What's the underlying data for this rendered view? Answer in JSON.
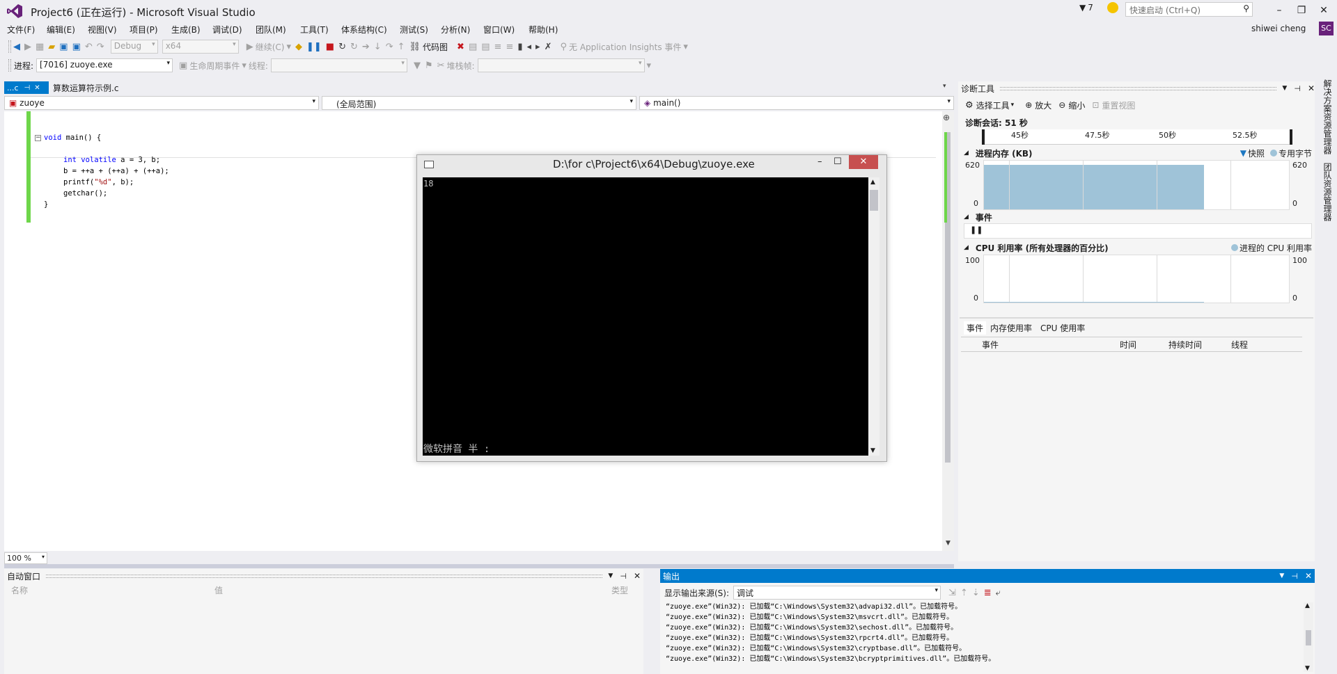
{
  "window": {
    "title": "Project6 (正在运行) - Microsoft Visual Studio",
    "notification_count": "7",
    "quick_launch_placeholder": "快速启动 (Ctrl+Q)",
    "user_name": "shiwei cheng",
    "user_initials": "SC"
  },
  "menu": [
    "文件(F)",
    "编辑(E)",
    "视图(V)",
    "项目(P)",
    "生成(B)",
    "调试(D)",
    "团队(M)",
    "工具(T)",
    "体系结构(C)",
    "测试(S)",
    "分析(N)",
    "窗口(W)",
    "帮助(H)"
  ],
  "toolbar": {
    "config": "Debug",
    "platform": "x64",
    "continue_label": "继续(C)",
    "code_map_label": "代码图",
    "app_insights_label": "无 Application Insights 事件"
  },
  "debug_toolbar": {
    "process_label": "进程:",
    "process_value": "[7016] zuoye.exe",
    "lifecycle_label": "生命周期事件",
    "thread_label": "线程:",
    "stack_label": "堆栈帧:"
  },
  "tabs": {
    "pinned": "...c",
    "active": "算数运算符示例.c"
  },
  "navbar": {
    "project": "zuoye",
    "scope": "(全局范围)",
    "member": "main()"
  },
  "code_lines": [
    "void main() {",
    "",
    "int  volatile a = 3, b;",
    "b = ++a + (++a) + (++a);",
    "printf(\"%d\", b);",
    "getchar();",
    "}"
  ],
  "zoom": "100 %",
  "console": {
    "title": "D:\\for c\\Project6\\x64\\Debug\\zuoye.exe",
    "output": "18",
    "ime": "微软拼音 半 :"
  },
  "diagnostics": {
    "title": "诊断工具",
    "select_tools": "选择工具",
    "zoom_in": "放大",
    "zoom_out": "缩小",
    "reset_view": "重置视图",
    "session": "诊断会话: 51 秒",
    "timeline_ticks": [
      "45秒",
      "47.5秒",
      "50秒",
      "52.5秒"
    ],
    "memory": {
      "title": "进程内存 (KB)",
      "legend_snapshot": "快照",
      "legend_private": "专用字节",
      "y_max": "620",
      "y_min": "0"
    },
    "events_title": "事件",
    "cpu": {
      "title": "CPU 利用率 (所有处理器的百分比)",
      "legend": "进程的 CPU 利用率",
      "y_max": "100",
      "y_min": "0"
    },
    "bottom_tabs": [
      "事件",
      "内存使用率",
      "CPU 使用率"
    ],
    "table_headers": [
      "事件",
      "时间",
      "持续时间",
      "线程"
    ]
  },
  "autos": {
    "title": "自动窗口",
    "headers": [
      "名称",
      "值",
      "类型"
    ]
  },
  "output": {
    "title": "输出",
    "source_label": "显示输出来源(S):",
    "source_value": "调试",
    "lines": [
      "“zuoye.exe”(Win32): 已加载“C:\\Windows\\System32\\advapi32.dll”。已加载符号。",
      "“zuoye.exe”(Win32): 已加载“C:\\Windows\\System32\\msvcrt.dll”。已加载符号。",
      "“zuoye.exe”(Win32): 已加载“C:\\Windows\\System32\\sechost.dll”。已加载符号。",
      "“zuoye.exe”(Win32): 已加载“C:\\Windows\\System32\\rpcrt4.dll”。已加载符号。",
      "“zuoye.exe”(Win32): 已加载“C:\\Windows\\System32\\cryptbase.dll”。已加载符号。",
      "“zuoye.exe”(Win32): 已加载“C:\\Windows\\System32\\bcryptprimitives.dll”。已加载符号。"
    ]
  },
  "right_rail": [
    "解决方案资源管理器",
    "团队资源管理器"
  ],
  "colors": {
    "accent": "#007acc",
    "vs_purple": "#68217a",
    "changed_green": "#6ed64a",
    "memory_fill": "#9fc3d8"
  }
}
